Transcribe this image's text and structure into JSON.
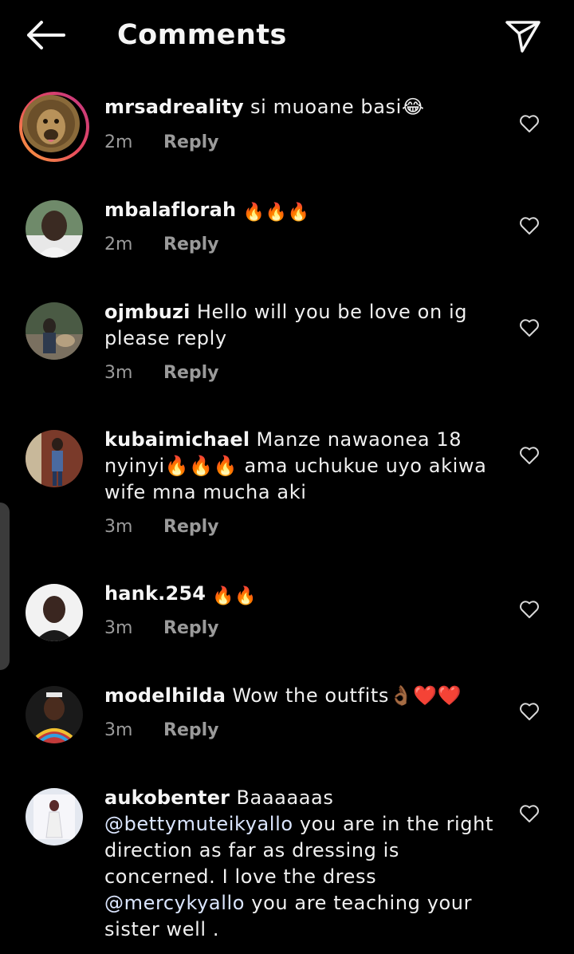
{
  "header": {
    "title": "Comments",
    "back_icon": "arrow-left-icon",
    "share_icon": "paper-plane-icon"
  },
  "reply_label": "Reply",
  "comments": [
    {
      "username": "mrsadreality",
      "text": "si muoane basi😂",
      "time": "2m",
      "story_ring": true
    },
    {
      "username": "mbalaflorah",
      "text": "🔥🔥🔥",
      "time": "2m"
    },
    {
      "username": "ojmbuzi",
      "text": "Hello will you be love on ig please reply",
      "time": "3m"
    },
    {
      "username": "kubaimichael",
      "text": "Manze nawaonea 18 nyinyi🔥🔥🔥 ama uchukue uyo akiwa wife mna mucha aki",
      "time": "3m"
    },
    {
      "username": "hank.254",
      "text": "🔥🔥",
      "time": "3m"
    },
    {
      "username": "modelhilda",
      "text": "Wow the outfits👌🏾❤️❤️",
      "time": "3m"
    },
    {
      "username": "aukobenter",
      "text_parts": [
        "Baaaaaas",
        "@bettymuteikyallo",
        "you are in the right direction as far as dressing is concerned. I love the dress",
        "@mercykyallo",
        "you are teaching your sister well ."
      ]
    }
  ],
  "colors": {
    "background": "#000000",
    "text": "#f0f0f0",
    "meta": "#9a9a9a",
    "story_ring_start": "#f9a03a",
    "story_ring_end": "#c13584"
  }
}
